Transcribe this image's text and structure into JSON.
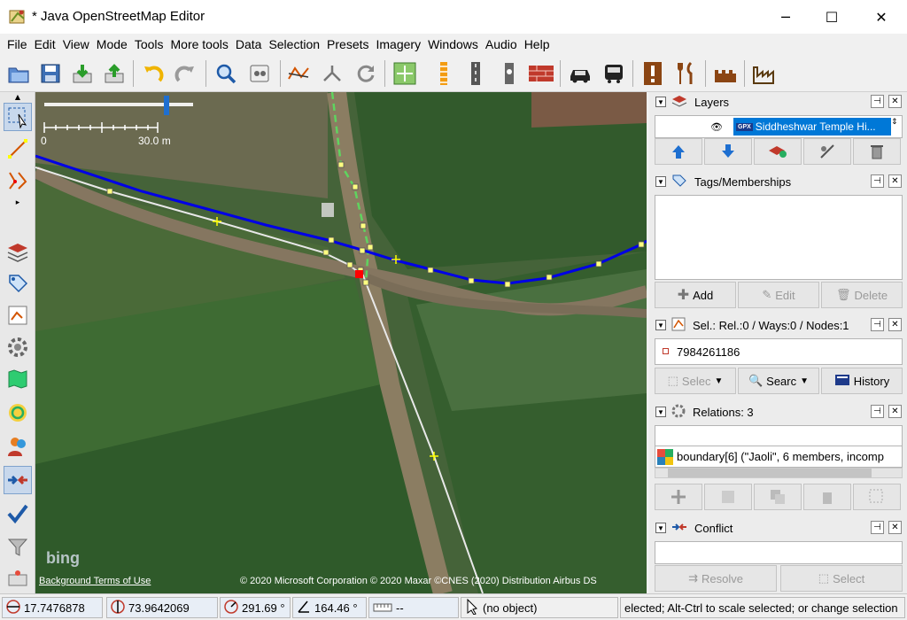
{
  "window": {
    "title": "* Java OpenStreetMap Editor",
    "minimize": "─",
    "maximize": "☐",
    "close": "✕"
  },
  "menu": [
    "File",
    "Edit",
    "View",
    "Mode",
    "Tools",
    "More tools",
    "Data",
    "Selection",
    "Presets",
    "Imagery",
    "Windows",
    "Audio",
    "Help"
  ],
  "toolbar": {
    "icons": [
      "open-icon",
      "save-icon",
      "download-icon",
      "upload-icon",
      "undo-icon",
      "redo-icon",
      "zoom-icon",
      "preferences-icon",
      "simplify-way-icon",
      "merge-nodes-icon",
      "refresh-icon",
      "map-move-icon",
      "barrier-icon",
      "road-icon",
      "lighthouse-icon",
      "brick-wall-icon",
      "car-icon",
      "bus-icon",
      "info-panel-icon",
      "restaurant-icon",
      "castle-icon",
      "factory-icon"
    ]
  },
  "map": {
    "scale_label_start": "0",
    "scale_label_end": "30.0 m",
    "bing_logo": "bing",
    "background_terms": "Background Terms of Use",
    "attribution": "© 2020 Microsoft Corporation © 2020 Maxar ©CNES (2020) Distribution Airbus DS"
  },
  "panels": {
    "layers": {
      "title": "Layers",
      "layer_name": "Siddheshwar Temple Hi...",
      "layer_badge": "GPX"
    },
    "tags": {
      "title": "Tags/Memberships",
      "add": "Add",
      "edit": "Edit",
      "delete": "Delete"
    },
    "selection": {
      "title": "Sel.: Rel.:0 / Ways:0 / Nodes:1",
      "item": "7984261186",
      "select": "Selec",
      "search": "Searc",
      "history": "History"
    },
    "relations": {
      "title": "Relations: 3",
      "item": "boundary[6] (\"Jaoli\", 6 members, incomp"
    },
    "conflict": {
      "title": "Conflict",
      "resolve": "Resolve",
      "select": "Select"
    }
  },
  "status": {
    "lat": "17.7476878",
    "lon": "73.9642069",
    "heading": "291.69 °",
    "angle": "164.46 °",
    "distance": "--",
    "object": "(no object)",
    "help": "elected; Alt-Ctrl to scale selected; or change selection"
  },
  "colors": {
    "selection_blue": "#0078d7",
    "way_blue": "#0000e6",
    "node_yellow": "#e6e600",
    "selected_red": "#ff0000"
  }
}
